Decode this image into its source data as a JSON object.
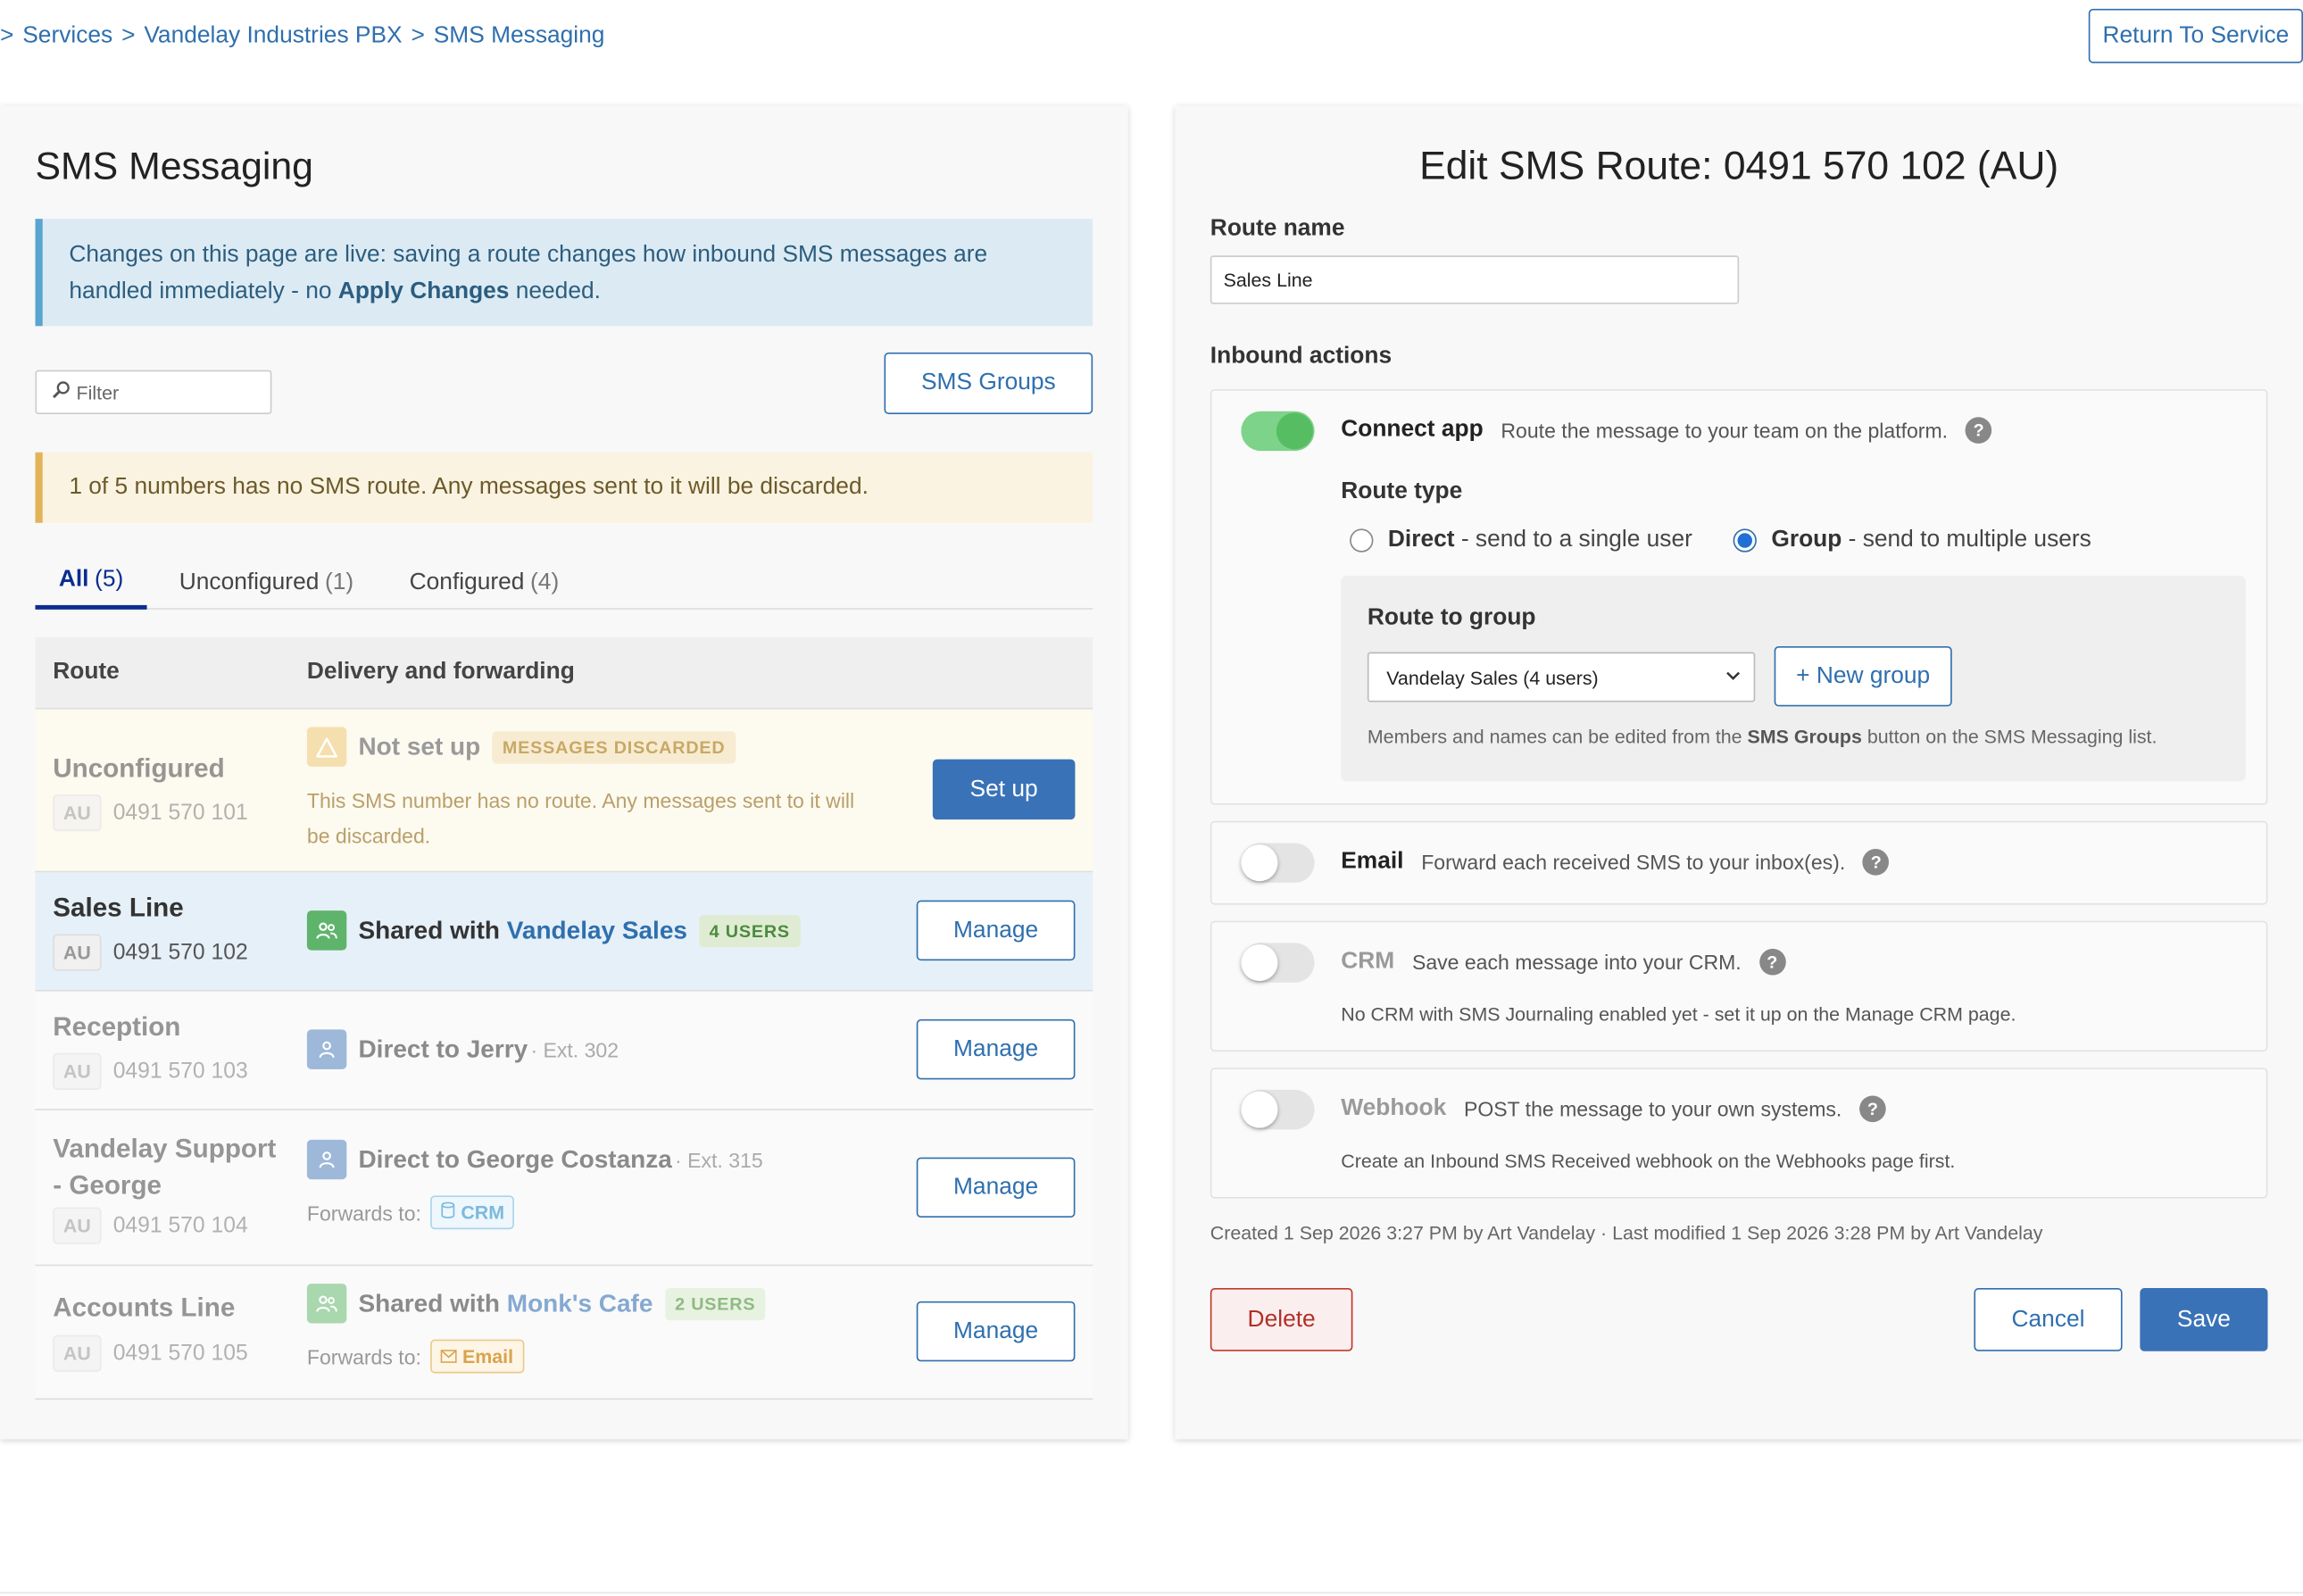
{
  "breadcrumb": {
    "lead": ">",
    "items": [
      "Services",
      "Vandelay Industries PBX",
      "SMS Messaging"
    ],
    "sep": ">"
  },
  "return_button": "Return To Service",
  "list": {
    "title": "SMS Messaging",
    "info": {
      "text_a": "Changes on this page are live: saving a route changes how inbound SMS messages are handled immediately - no ",
      "bold": "Apply Changes",
      "text_b": " needed."
    },
    "filter_placeholder": "Filter",
    "sms_groups_button": "SMS Groups",
    "warning": "1 of 5 numbers has no SMS route. Any messages sent to it will be discarded.",
    "tabs": [
      {
        "label": "All",
        "count": "(5)"
      },
      {
        "label": "Unconfigured",
        "count": "(1)"
      },
      {
        "label": "Configured",
        "count": "(4)"
      }
    ],
    "columns": {
      "route": "Route",
      "delivery": "Delivery and forwarding"
    },
    "rows": [
      {
        "name": "Unconfigured",
        "country": "AU",
        "number": "0491 570 101",
        "status": "Not set up",
        "badge": "MESSAGES DISCARDED",
        "desc": "This SMS number has no route. Any messages sent to it will be discarded.",
        "action": "Set up"
      },
      {
        "name": "Sales Line",
        "country": "AU",
        "number": "0491 570 102",
        "prefix": "Shared with ",
        "target": "Vandelay Sales",
        "badge": "4 USERS",
        "action": "Manage"
      },
      {
        "name": "Reception",
        "country": "AU",
        "number": "0491 570 103",
        "prefix": "Direct to Jerry",
        "ext": " · Ext. 302",
        "action": "Manage"
      },
      {
        "name": "Vandelay Support - George",
        "country": "AU",
        "number": "0491 570 104",
        "prefix": "Direct to George Costanza",
        "ext": " · Ext. 315",
        "forwards_label": "Forwards to:",
        "forward": "CRM",
        "action": "Manage"
      },
      {
        "name": "Accounts Line",
        "country": "AU",
        "number": "0491 570 105",
        "prefix": "Shared with ",
        "target": "Monk's Cafe",
        "badge": "2 USERS",
        "forwards_label": "Forwards to:",
        "forward": "Email",
        "action": "Manage"
      }
    ]
  },
  "editor": {
    "title": "Edit SMS Route: 0491 570 102 (AU)",
    "route_name_label": "Route name",
    "route_name_value": "Sales Line",
    "inbound_label": "Inbound actions",
    "connect": {
      "title": "Connect app",
      "desc": "Route the message to your team on the platform.",
      "enabled": true
    },
    "route_type_label": "Route type",
    "direct": {
      "bold": "Direct",
      "text": " - send to a single user"
    },
    "group": {
      "bold": "Group",
      "text": " - send to multiple users"
    },
    "route_to_group_label": "Route to group",
    "group_select": "Vandelay Sales (4 users)",
    "new_group_button": "+ New group",
    "group_note": {
      "a": "Members and names can be edited from the ",
      "b": "SMS Groups",
      "c": " button on the SMS Messaging list."
    },
    "email": {
      "title": "Email",
      "desc": "Forward each received SMS to your inbox(es).",
      "enabled": false
    },
    "crm": {
      "title": "CRM",
      "desc": "Save each message into your CRM.",
      "note": "No CRM with SMS Journaling enabled yet - set it up on the Manage CRM page.",
      "enabled": false
    },
    "webhook": {
      "title": "Webhook",
      "desc": "POST the message to your own systems.",
      "note": "Create an Inbound SMS Received webhook on the Webhooks page first.",
      "enabled": false
    },
    "meta": "Created 1 Sep 2026 3:27 PM by Art Vandelay · Last modified 1 Sep 2026 3:28 PM by Art Vandelay",
    "delete_button": "Delete",
    "cancel_button": "Cancel",
    "save_button": "Save"
  },
  "icons": {
    "warning": "warning-triangle-icon",
    "group": "users-icon",
    "user": "user-icon",
    "crm": "database-icon",
    "email": "envelope-icon",
    "help": "help-icon",
    "search": "search-icon",
    "chevron": "chevron-down-icon"
  },
  "colors": {
    "link": "#2f6fae",
    "accent_tab": "#0b2d8f",
    "save": "#3a72b8",
    "toggle_on": "#57bd63",
    "delete": "#b03028"
  }
}
